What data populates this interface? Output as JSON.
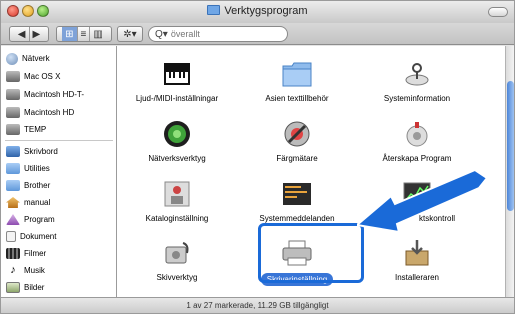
{
  "window": {
    "title": "Verktygsprogram"
  },
  "toolbar": {
    "back_label": "◀",
    "forward_label": "▶",
    "view_icon_label": "⊞",
    "view_list_label": "≡",
    "view_column_label": "▥",
    "action_label": "✲▾",
    "search_placeholder": "överallt"
  },
  "sidebar": {
    "devices": [
      {
        "label": "Nätverk",
        "icon": "network-globe-icon"
      },
      {
        "label": "Mac OS X",
        "icon": "hard-drive-icon"
      },
      {
        "label": "Macintosh HD-T-",
        "icon": "hard-drive-icon"
      },
      {
        "label": "Macintosh HD",
        "icon": "hard-drive-icon"
      },
      {
        "label": "TEMP",
        "icon": "hard-drive-icon"
      }
    ],
    "places": [
      {
        "label": "Skrivbord",
        "icon": "desktop-icon"
      },
      {
        "label": "Utilities",
        "icon": "folder-icon"
      },
      {
        "label": "Brother",
        "icon": "folder-icon"
      },
      {
        "label": "manual",
        "icon": "home-icon"
      },
      {
        "label": "Program",
        "icon": "applications-icon"
      },
      {
        "label": "Dokument",
        "icon": "documents-icon"
      },
      {
        "label": "Filmer",
        "icon": "movies-icon"
      },
      {
        "label": "Musik",
        "icon": "music-icon"
      },
      {
        "label": "Bilder",
        "icon": "pictures-icon"
      }
    ]
  },
  "items": [
    {
      "label": "Ljud-/MIDI-inställningar",
      "icon": "midi-keyboard-icon"
    },
    {
      "label": "Asien texttillbehör",
      "icon": "folder-icon"
    },
    {
      "label": "Systeminformation",
      "icon": "system-profiler-icon"
    },
    {
      "label": "Nätverksverktyg",
      "icon": "network-utility-icon"
    },
    {
      "label": "Färgmätare",
      "icon": "colorsync-meter-icon"
    },
    {
      "label": "Återskapa Program",
      "icon": "restore-icon"
    },
    {
      "label": "Kataloginställning",
      "icon": "directory-icon"
    },
    {
      "label": "Systemmeddelanden",
      "icon": "console-icon"
    },
    {
      "label": "ktskontroll",
      "icon": "activity-monitor-icon"
    },
    {
      "label": "Skivverktyg",
      "icon": "disk-utility-icon"
    },
    {
      "label": "Skrivarinställning",
      "icon": "printer-icon",
      "selected": true
    },
    {
      "label": "Installeraren",
      "icon": "installer-icon"
    }
  ],
  "status": {
    "text": "1 av 27 markerade, 11.29 GB tillgängligt"
  },
  "colors": {
    "selection": "#3875d7",
    "annotation": "#1a6ad8"
  }
}
